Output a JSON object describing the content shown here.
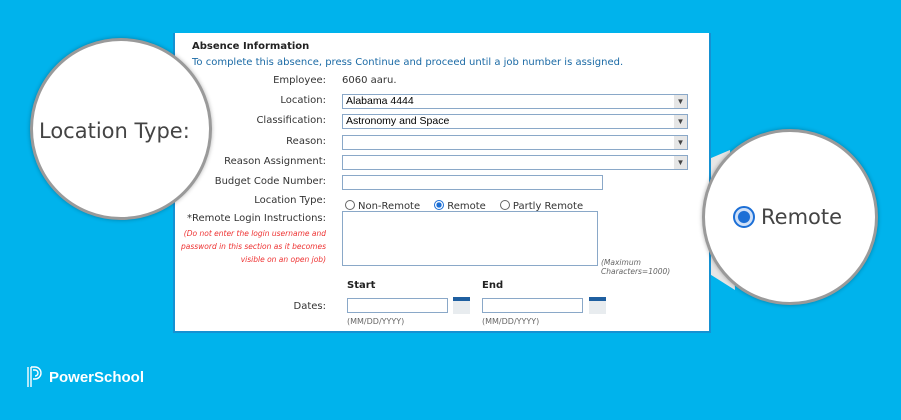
{
  "form": {
    "section_title": "Absence Information",
    "instructions": "To complete this absence, press Continue and proceed until a job number is assigned.",
    "employee_label": "Employee:",
    "employee_value": "6060 aaru.",
    "location_label": "Location:",
    "location_value": "Alabama 4444",
    "classification_label": "Classification:",
    "classification_value": "Astronomy and Space",
    "reason_label": "Reason:",
    "reason_value": "",
    "reason_assignment_label": "Reason Assignment:",
    "reason_assignment_value": "",
    "budget_label": "Budget Code Number:",
    "budget_value": "",
    "location_type_label": "Location Type:",
    "location_type_options": [
      "Non-Remote",
      "Remote",
      "Partly Remote"
    ],
    "location_type_selected": "Remote",
    "remote_label": "*Remote Login Instructions:",
    "remote_warning": "(Do not enter the login username and password in this section as it becomes visible on an open job)",
    "max_chars": "(Maximum Characters=1000)",
    "dates_label": "Dates:",
    "start_label": "Start",
    "end_label": "End",
    "date_format": "(MM/DD/YYYY)"
  },
  "zoom_left": {
    "text": "Location Type:"
  },
  "zoom_right": {
    "text": "Remote"
  },
  "brand": {
    "name": "PowerSchool"
  },
  "colors": {
    "background": "#00b3ec",
    "accent": "#1c6fd6",
    "warning": "#e33333"
  }
}
